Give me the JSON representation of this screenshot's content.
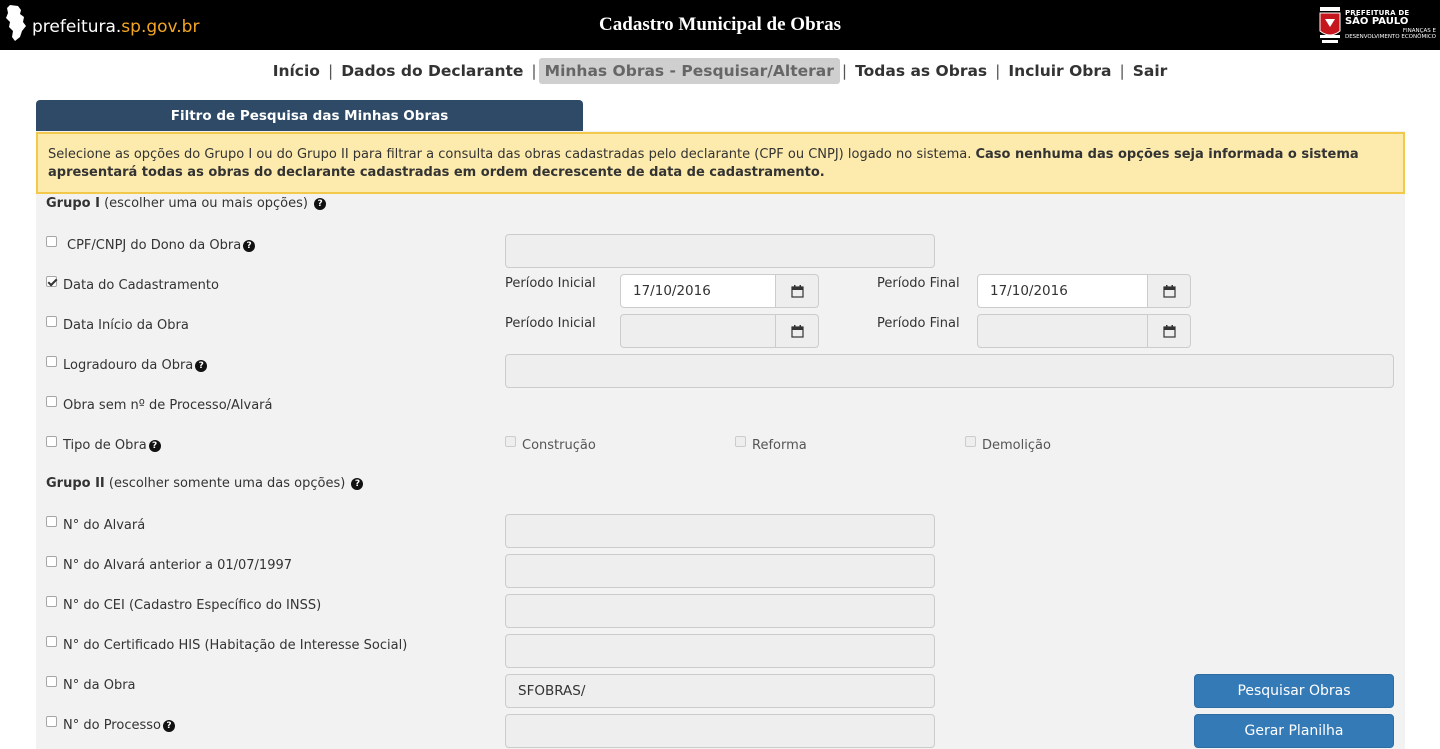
{
  "header": {
    "brand_prefix": "prefeitura.",
    "brand_accent": "sp.gov.br",
    "title": "Cadastro Municipal de Obras",
    "logo_line1": "PREFEITURA DE",
    "logo_line2": "SÃO PAULO",
    "logo_line3": "FINANÇAS E",
    "logo_line4": "DESENVOLVIMENTO ECONÔMICO"
  },
  "nav": {
    "items": [
      {
        "label": "Início"
      },
      {
        "label": "Dados do Declarante"
      },
      {
        "label": "Minhas Obras - Pesquisar/Alterar",
        "active": true
      },
      {
        "label": "Todas as Obras"
      },
      {
        "label": "Incluir Obra"
      },
      {
        "label": "Sair"
      }
    ],
    "separator": "|"
  },
  "panel": {
    "tab_title": "Filtro de Pesquisa das Minhas Obras",
    "alert_text": "Selecione as opções do Grupo I ou do Grupo II para filtrar a consulta das obras cadastradas pelo declarante (CPF ou CNPJ) logado no sistema. ",
    "alert_bold": "Caso nenhuma das opções seja informada o sistema apresentará todas as obras do declarante cadastradas em ordem decrescente de data de cadastramento."
  },
  "group1": {
    "title": "Grupo I",
    "hint": "(escolher uma ou mais opções)",
    "cpf_label": "CPF/CNPJ do Dono da Obra",
    "data_cad_label": "Data do Cadastramento",
    "data_cad_checked": true,
    "data_inicio_label": "Data Início da Obra",
    "periodo_inicial": "Período Inicial",
    "periodo_final": "Período Final",
    "data_cad_inicial": "17/10/2016",
    "data_cad_final": "17/10/2016",
    "logradouro_label": "Logradouro da Obra",
    "sem_processo_label": "Obra sem nº de Processo/Alvará",
    "tipo_label": "Tipo de Obra",
    "tipo_options": [
      "Construção",
      "Reforma",
      "Demolição"
    ]
  },
  "group2": {
    "title": "Grupo II",
    "hint": "(escolher somente uma das opções)",
    "alvara_label": "N° do Alvará",
    "alvara_anterior_label": "N° do Alvará anterior a 01/07/1997",
    "cei_label": "N° do CEI (Cadastro Específico do INSS)",
    "his_label": "N° do Certificado HIS (Habitação de Interesse Social)",
    "obra_label": "N° da Obra",
    "obra_value": "SFOBRAS/",
    "processo_label": "N° do Processo"
  },
  "actions": {
    "search": "Pesquisar Obras",
    "spreadsheet": "Gerar Planilha"
  },
  "help_glyph": "?",
  "colors": {
    "header_bg": "#000000",
    "tab_bg": "#2e4a66",
    "alert_bg": "#fdebad",
    "primary": "#337ab7"
  }
}
